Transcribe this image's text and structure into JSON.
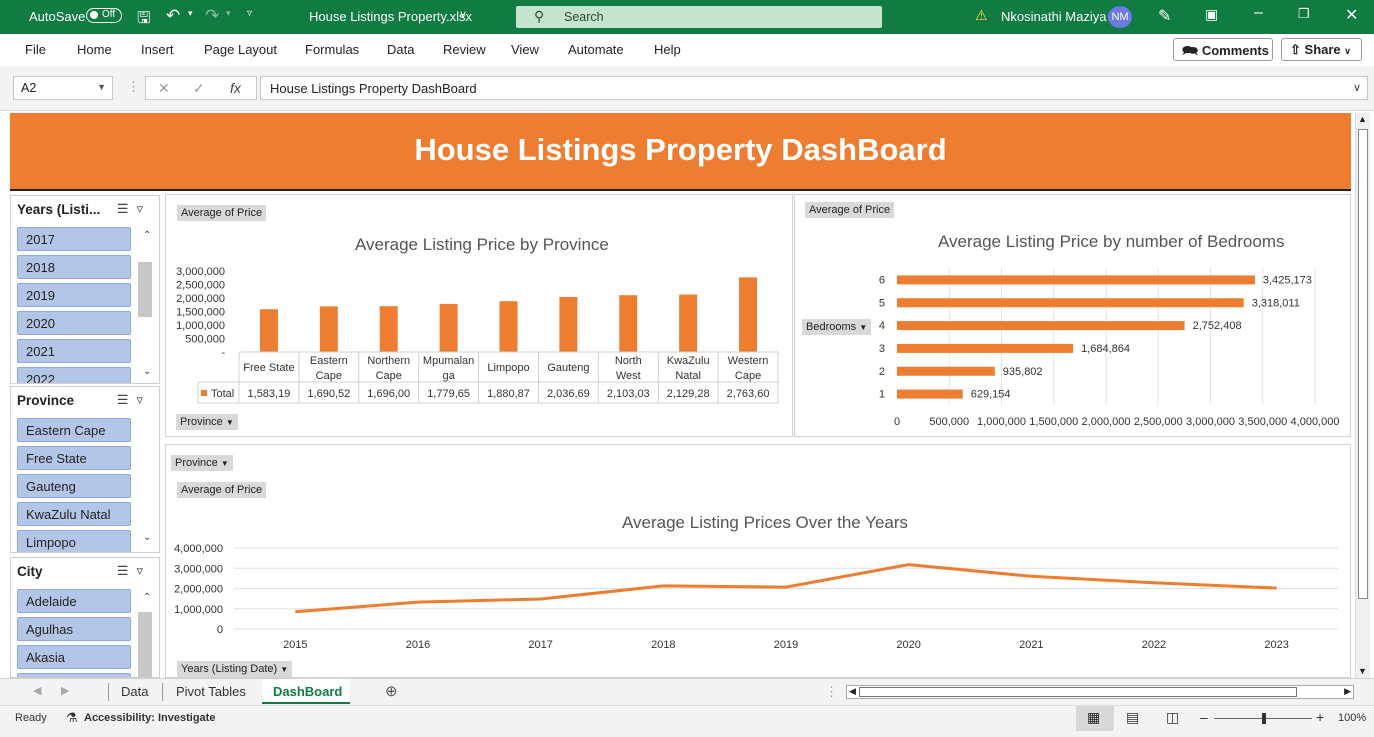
{
  "titlebar": {
    "autosave_label": "AutoSave",
    "autosave_state": "Off",
    "filename": "House Listings Property.xlsx",
    "search_placeholder": "Search",
    "user_name": "Nkosinathi Maziya",
    "user_initials": "NM"
  },
  "ribbon": {
    "tabs": [
      "File",
      "Home",
      "Insert",
      "Page Layout",
      "Formulas",
      "Data",
      "Review",
      "View",
      "Automate",
      "Help"
    ],
    "comments_label": "Comments",
    "share_label": "Share"
  },
  "formula_bar": {
    "cell_ref": "A2",
    "content": "House Listings Property DashBoard"
  },
  "dashboard": {
    "banner_title": "House Listings Property DashBoard"
  },
  "slicers": {
    "years": {
      "title": "Years (Listi...",
      "items": [
        "2017",
        "2018",
        "2019",
        "2020",
        "2021",
        "2022"
      ]
    },
    "province": {
      "title": "Province",
      "items": [
        "Eastern Cape",
        "Free State",
        "Gauteng",
        "KwaZulu Natal",
        "Limpopo"
      ]
    },
    "city": {
      "title": "City",
      "items": [
        "Adelaide",
        "Agulhas",
        "Akasia"
      ]
    }
  },
  "field_buttons": {
    "avg_price_1": "Average of Price",
    "province_1": "Province",
    "avg_price_2": "Average of Price",
    "bedrooms": "Bedrooms",
    "province_2": "Province",
    "avg_price_3": "Average of Price",
    "years_listing": "Years (Listing Date)"
  },
  "chart_data": [
    {
      "type": "bar",
      "title": "Average Listing Price by Province",
      "categories": [
        "Free State",
        "Eastern Cape",
        "Northern Cape",
        "Mpumalanga",
        "Limpopo",
        "Gauteng",
        "North West",
        "KwaZulu Natal",
        "Western Cape"
      ],
      "category_lines": [
        [
          "Free State"
        ],
        [
          "Eastern",
          "Cape"
        ],
        [
          "Northern",
          "Cape"
        ],
        [
          "Mpumalan",
          "ga"
        ],
        [
          "Limpopo"
        ],
        [
          "Gauteng"
        ],
        [
          "North",
          "West"
        ],
        [
          "KwaZulu",
          "Natal"
        ],
        [
          "Western",
          "Cape"
        ]
      ],
      "values": [
        1583190,
        1690520,
        1696000,
        1779650,
        1880870,
        2036690,
        2103030,
        2129280,
        2763600
      ],
      "table_row_label": "Total",
      "table_values": [
        "1,583,19",
        "1,690,52",
        "1,696,00",
        "1,779,65",
        "1,880,87",
        "2,036,69",
        "2,103,03",
        "2,129,28",
        "2,763,60"
      ],
      "yticks": [
        "3,000,000",
        "2,500,000",
        "2,000,000",
        "1,500,000",
        "1,000,000",
        "500,000",
        "-"
      ],
      "ylim": [
        0,
        3000000
      ],
      "color": "#ed7d31"
    },
    {
      "type": "bar",
      "orientation": "horizontal",
      "title": "Average Listing Price  by number of Bedrooms",
      "categories": [
        "6",
        "5",
        "4",
        "3",
        "2",
        "1"
      ],
      "values": [
        3425173,
        3318011,
        2752408,
        1684864,
        935802,
        629154
      ],
      "labels": [
        "3,425,173",
        "3,318,011",
        "2,752,408",
        "1,684,864",
        "935,802",
        "629,154"
      ],
      "xticks": [
        "0",
        "500,000",
        "1,000,000",
        "1,500,000",
        "2,000,000",
        "2,500,000",
        "3,000,000",
        "3,500,000",
        "4,000,000"
      ],
      "xlim": [
        0,
        4000000
      ],
      "color": "#ed7d31"
    },
    {
      "type": "line",
      "title": "Average Listing Prices Over the Years",
      "x": [
        "2015",
        "2016",
        "2017",
        "2018",
        "2019",
        "2020",
        "2021",
        "2022",
        "2023"
      ],
      "values": [
        850000,
        1330000,
        1480000,
        2130000,
        2070000,
        3180000,
        2600000,
        2280000,
        2020000
      ],
      "yticks": [
        "4,000,000",
        "3,000,000",
        "2,000,000",
        "1,000,000",
        "0"
      ],
      "ylim": [
        0,
        4000000
      ],
      "color": "#ed7d31"
    }
  ],
  "sheet_tabs": {
    "items": [
      "Data",
      "Pivot Tables",
      "DashBoard"
    ],
    "active": "DashBoard"
  },
  "statusbar": {
    "ready": "Ready",
    "accessibility": "Accessibility: Investigate",
    "zoom": "100%"
  }
}
